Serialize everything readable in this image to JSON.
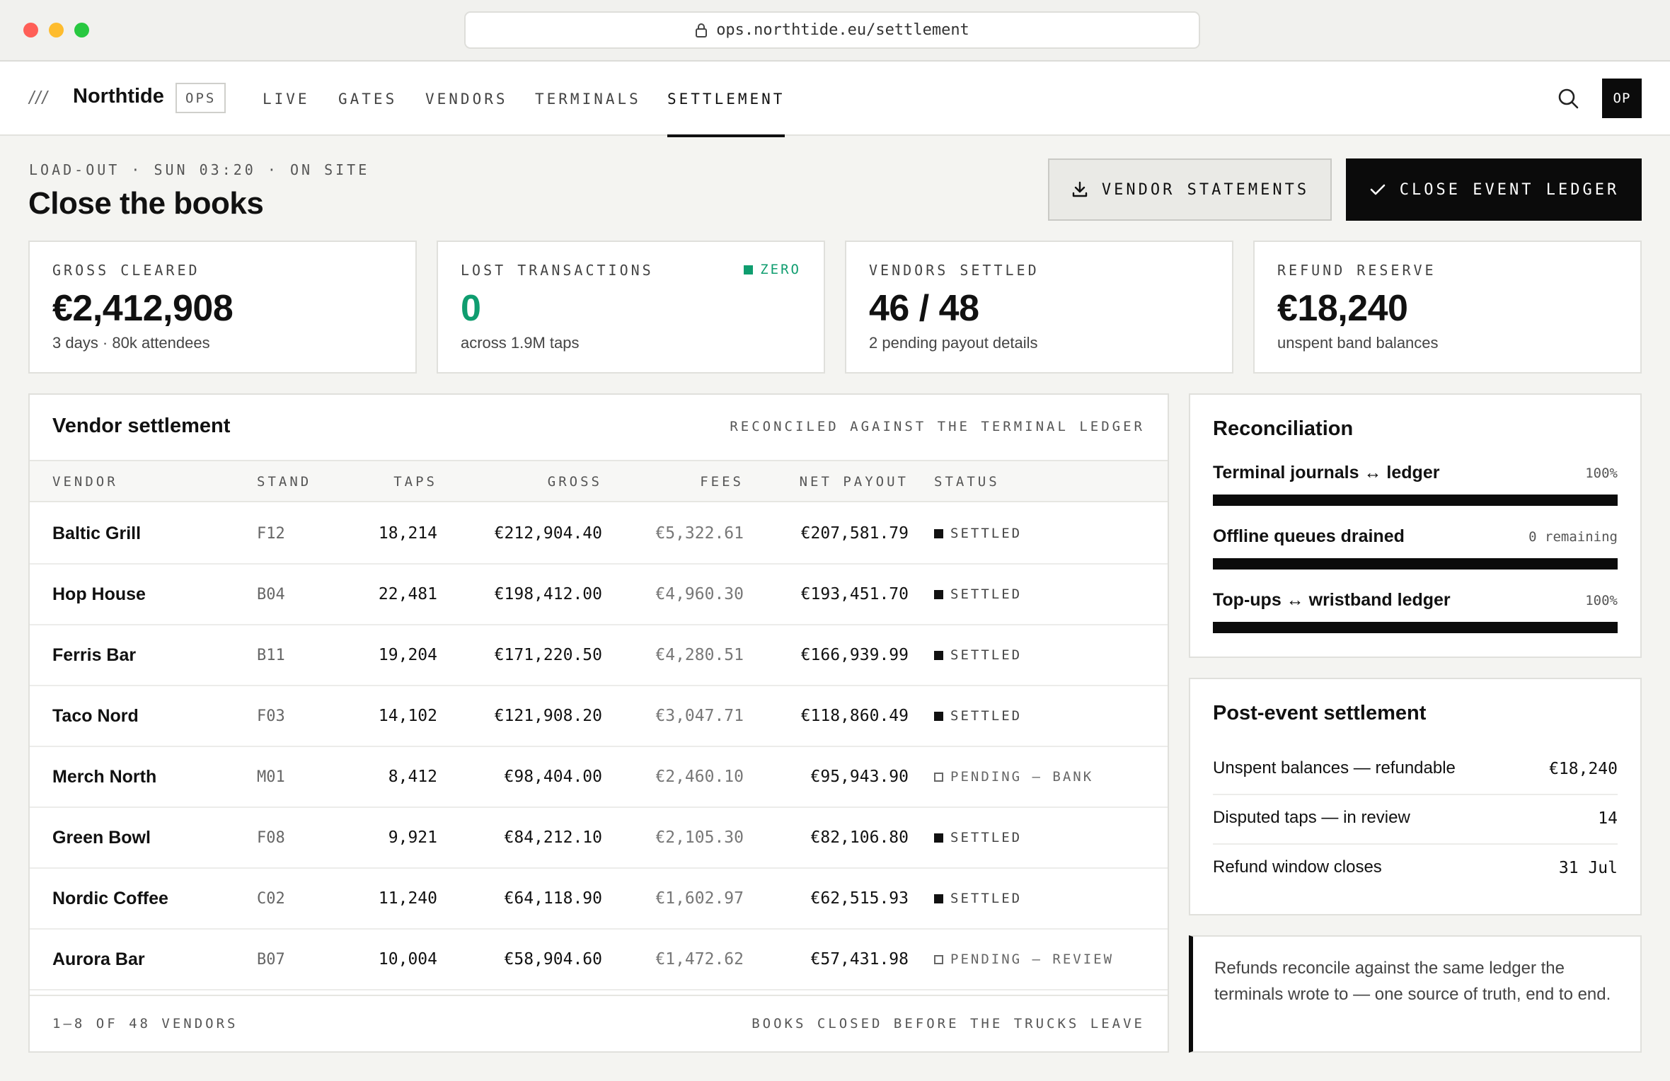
{
  "browser": {
    "url": "ops.northtide.eu/settlement"
  },
  "brand": {
    "slashes": "///",
    "name": "Northtide",
    "badge": "OPS"
  },
  "nav": {
    "tabs": [
      {
        "label": "LIVE"
      },
      {
        "label": "GATES"
      },
      {
        "label": "VENDORS"
      },
      {
        "label": "TERMINALS"
      },
      {
        "label": "SETTLEMENT",
        "active": true
      }
    ],
    "avatar": "OP"
  },
  "header": {
    "eyebrow": "LOAD-OUT · SUN 03:20 · ON SITE",
    "title": "Close the books",
    "vendor_statements": "VENDOR STATEMENTS",
    "close_ledger": "CLOSE EVENT LEDGER"
  },
  "kpis": [
    {
      "label": "GROSS CLEARED",
      "value": "€2,412,908",
      "sub": "3 days · 80k attendees"
    },
    {
      "label": "LOST TRANSACTIONS",
      "value": "0",
      "sub": "across 1.9M taps",
      "flag": "ZERO"
    },
    {
      "label": "VENDORS SETTLED",
      "value": "46 / 48",
      "sub": "2 pending payout details"
    },
    {
      "label": "REFUND RESERVE",
      "value": "€18,240",
      "sub": "unspent band balances"
    }
  ],
  "vendor_table": {
    "title": "Vendor settlement",
    "meta": "RECONCILED AGAINST THE TERMINAL LEDGER",
    "columns": [
      "VENDOR",
      "STAND",
      "TAPS",
      "GROSS",
      "FEES",
      "NET PAYOUT",
      "STATUS"
    ],
    "rows": [
      {
        "vendor": "Baltic Grill",
        "stand": "F12",
        "taps": "18,214",
        "gross": "€212,904.40",
        "fees": "€5,322.61",
        "net": "€207,581.79",
        "status": "SETTLED",
        "settled": true
      },
      {
        "vendor": "Hop House",
        "stand": "B04",
        "taps": "22,481",
        "gross": "€198,412.00",
        "fees": "€4,960.30",
        "net": "€193,451.70",
        "status": "SETTLED",
        "settled": true
      },
      {
        "vendor": "Ferris Bar",
        "stand": "B11",
        "taps": "19,204",
        "gross": "€171,220.50",
        "fees": "€4,280.51",
        "net": "€166,939.99",
        "status": "SETTLED",
        "settled": true
      },
      {
        "vendor": "Taco Nord",
        "stand": "F03",
        "taps": "14,102",
        "gross": "€121,908.20",
        "fees": "€3,047.71",
        "net": "€118,860.49",
        "status": "SETTLED",
        "settled": true
      },
      {
        "vendor": "Merch North",
        "stand": "M01",
        "taps": "8,412",
        "gross": "€98,404.00",
        "fees": "€2,460.10",
        "net": "€95,943.90",
        "status": "PENDING – BANK",
        "settled": false
      },
      {
        "vendor": "Green Bowl",
        "stand": "F08",
        "taps": "9,921",
        "gross": "€84,212.10",
        "fees": "€2,105.30",
        "net": "€82,106.80",
        "status": "SETTLED",
        "settled": true
      },
      {
        "vendor": "Nordic Coffee",
        "stand": "C02",
        "taps": "11,240",
        "gross": "€64,118.90",
        "fees": "€1,602.97",
        "net": "€62,515.93",
        "status": "SETTLED",
        "settled": true
      },
      {
        "vendor": "Aurora Bar",
        "stand": "B07",
        "taps": "10,004",
        "gross": "€58,904.60",
        "fees": "€1,472.62",
        "net": "€57,431.98",
        "status": "PENDING – REVIEW",
        "settled": false
      }
    ],
    "footer_left": "1–8 OF 48 VENDORS",
    "footer_right": "BOOKS CLOSED BEFORE THE TRUCKS LEAVE"
  },
  "reconciliation": {
    "title": "Reconciliation",
    "items": [
      {
        "label": "Terminal journals ↔ ledger",
        "value": "100%",
        "progress": 1.0
      },
      {
        "label": "Offline queues drained",
        "value": "0 remaining",
        "progress": 1.0
      },
      {
        "label": "Top-ups ↔ wristband ledger",
        "value": "100%",
        "progress": 1.0
      }
    ]
  },
  "post_event": {
    "title": "Post-event settlement",
    "rows": [
      {
        "label": "Unspent balances — refundable",
        "value": "€18,240"
      },
      {
        "label": "Disputed taps — in review",
        "value": "14"
      },
      {
        "label": "Refund window closes",
        "value": "31 Jul"
      }
    ]
  },
  "note": "Refunds reconcile against the same ledger the terminals wrote to — one source of truth, end to end.",
  "colors": {
    "accent_green": "#0f9d6f",
    "ink": "#0b0b0b"
  }
}
